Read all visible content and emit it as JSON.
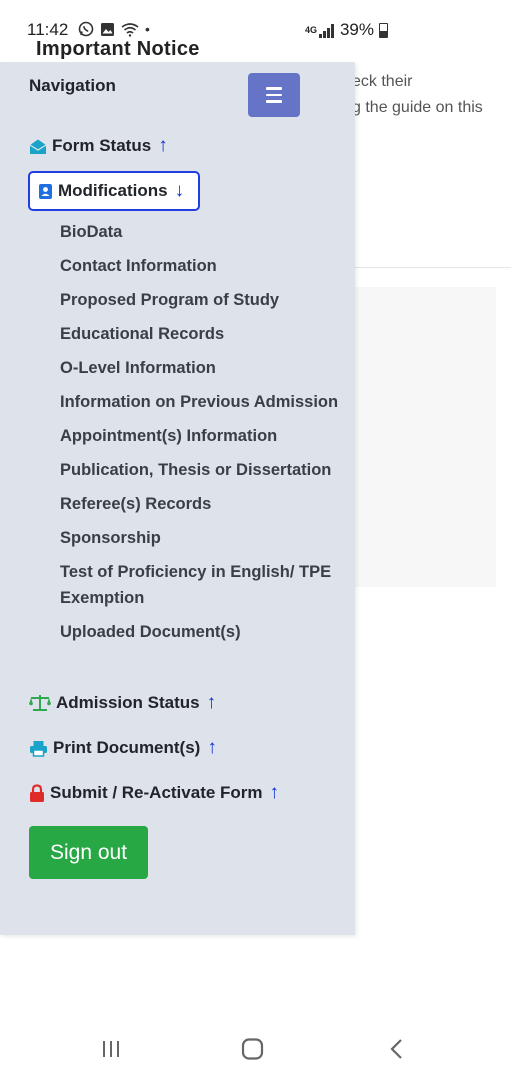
{
  "status_bar": {
    "time": "11:42",
    "dot": "•",
    "network": "4G",
    "battery": "39%"
  },
  "background_page": {
    "heading": "Important Notice",
    "text_line_1": "eck their",
    "text_line_2": "g the guide on this"
  },
  "drawer": {
    "title": "Navigation",
    "form_status": "Form Status",
    "modifications": "Modifications",
    "sub_items": [
      "BioData",
      "Contact Information",
      "Proposed Program of Study",
      "Educational Records",
      "O-Level Information",
      "Information on Previous Admission",
      "Appointment(s) Information",
      "Publication, Thesis or Dissertation",
      "Referee(s) Records",
      "Sponsorship",
      "Test of Proficiency in English/ TPE Exemption",
      "Uploaded Document(s)"
    ],
    "admission_status": "Admission Status",
    "print_documents": "Print Document(s)",
    "submit_form": "Submit / Re-Activate Form",
    "sign_out": "Sign out"
  },
  "icons": {
    "form_status": "envelope-open-icon",
    "modifications": "address-book-icon",
    "admission_status": "balance-scale-icon",
    "print_documents": "printer-icon",
    "submit_form": "lock-icon"
  },
  "colors": {
    "drawer_bg": "#dee2eb",
    "toggle_button": "#6674c8",
    "sign_out": "#28a745",
    "active_border": "#1f3fe0",
    "arrow": "#0a2fd6"
  }
}
